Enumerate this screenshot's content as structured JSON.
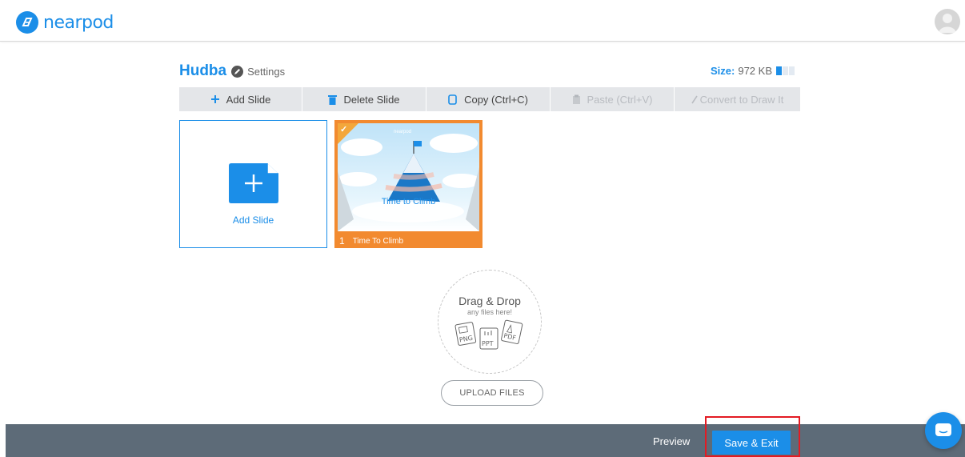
{
  "header": {
    "logo_text": "nearpod"
  },
  "presentation": {
    "title": "Hudba",
    "settings_label": "Settings",
    "size_label": "Size:",
    "size_value": "972 KB",
    "size_usage_fraction": 0.33
  },
  "toolbar": {
    "add_slide": "Add Slide",
    "delete_slide": "Delete Slide",
    "copy": "Copy (Ctrl+C)",
    "paste": "Paste (Ctrl+V)",
    "convert": "Convert to Draw It"
  },
  "slides": {
    "add_slide_label": "Add Slide",
    "items": [
      {
        "number": "1",
        "name": "Time To Climb",
        "thumb_caption": "Time to Climb",
        "thumb_logo": "nearpod",
        "selected": true
      }
    ]
  },
  "dropzone": {
    "title": "Drag & Drop",
    "subtitle": "any files here!",
    "file_types": [
      "PNG",
      "PPT",
      "PDF"
    ],
    "upload_label": "UPLOAD FILES"
  },
  "footer": {
    "preview_label": "Preview",
    "save_label": "Save & Exit"
  },
  "colors": {
    "accent": "#1b8ee8",
    "slide_selected": "#f28a2f",
    "footer_bg": "#5d6b78",
    "highlight": "#e31b23"
  }
}
